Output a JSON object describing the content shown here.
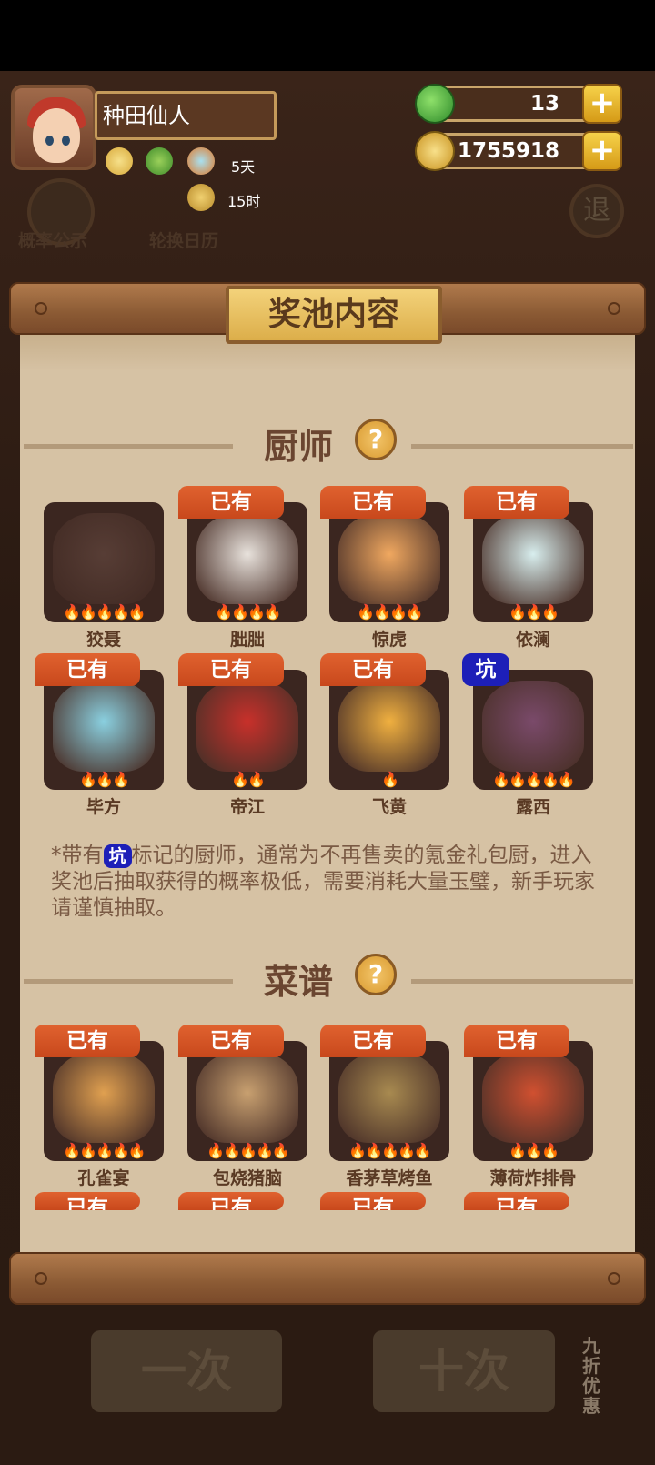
{
  "hud": {
    "player_name": "种田仙人",
    "stats": [
      {
        "icon": "coin-upgrade-icon"
      },
      {
        "icon": "plant-upgrade-icon"
      },
      {
        "icon": "fish-upgrade-icon",
        "label": "5天"
      },
      {
        "icon": "key-upgrade-icon",
        "label": "15时"
      }
    ],
    "resources": [
      {
        "icon": "jade-apple-icon",
        "value": "13"
      },
      {
        "icon": "gold-coin-icon",
        "value": "1755918"
      }
    ]
  },
  "background": {
    "probability_label": "概率公示",
    "calendar_label": "轮换日历",
    "exit_label": "退",
    "single_draw": "一次",
    "ten_draw": "十次",
    "discount_label": "九折优惠"
  },
  "panel": {
    "title": "奖池内容",
    "chef_section": {
      "title": "厨师",
      "chefs": [
        {
          "name": "狡聂",
          "tag": "",
          "flames": 5,
          "color": "#7a5a50"
        },
        {
          "name": "朏朏",
          "tag": "已有",
          "flames": 4,
          "color": "#e8e2dc"
        },
        {
          "name": "惊虎",
          "tag": "已有",
          "flames": 4,
          "color": "#f0a860"
        },
        {
          "name": "依澜",
          "tag": "已有",
          "flames": 3,
          "color": "#d8eeee"
        },
        {
          "name": "毕方",
          "tag": "已有",
          "flames": 3,
          "color": "#8ad0e0"
        },
        {
          "name": "帝江",
          "tag": "已有",
          "flames": 2,
          "color": "#c8302a"
        },
        {
          "name": "飞黄",
          "tag": "已有",
          "flames": 1,
          "color": "#f0b040"
        },
        {
          "name": "露西",
          "tag": "坑",
          "flames": 5,
          "color": "#7a4a6a"
        }
      ]
    },
    "note": {
      "prefix": "*带有",
      "pit": "坑",
      "suffix": "标记的厨师，通常为不再售卖的氪金礼包厨，进入奖池后抽取获得的概率极低，需要消耗大量玉璧，新手玩家请谨慎抽取。"
    },
    "recipe_section": {
      "title": "菜谱",
      "recipes": [
        {
          "name": "孔雀宴",
          "tag": "已有",
          "flames": 5,
          "color": "#e0a050"
        },
        {
          "name": "包烧猪脑",
          "tag": "已有",
          "flames": 5,
          "color": "#c8a070"
        },
        {
          "name": "香茅草烤鱼",
          "tag": "已有",
          "flames": 5,
          "color": "#a88a50"
        },
        {
          "name": "薄荷炸排骨",
          "tag": "已有",
          "flames": 3,
          "color": "#d05030"
        }
      ],
      "next_row_tags": [
        "已有",
        "已有",
        "已有",
        "已有"
      ]
    }
  }
}
